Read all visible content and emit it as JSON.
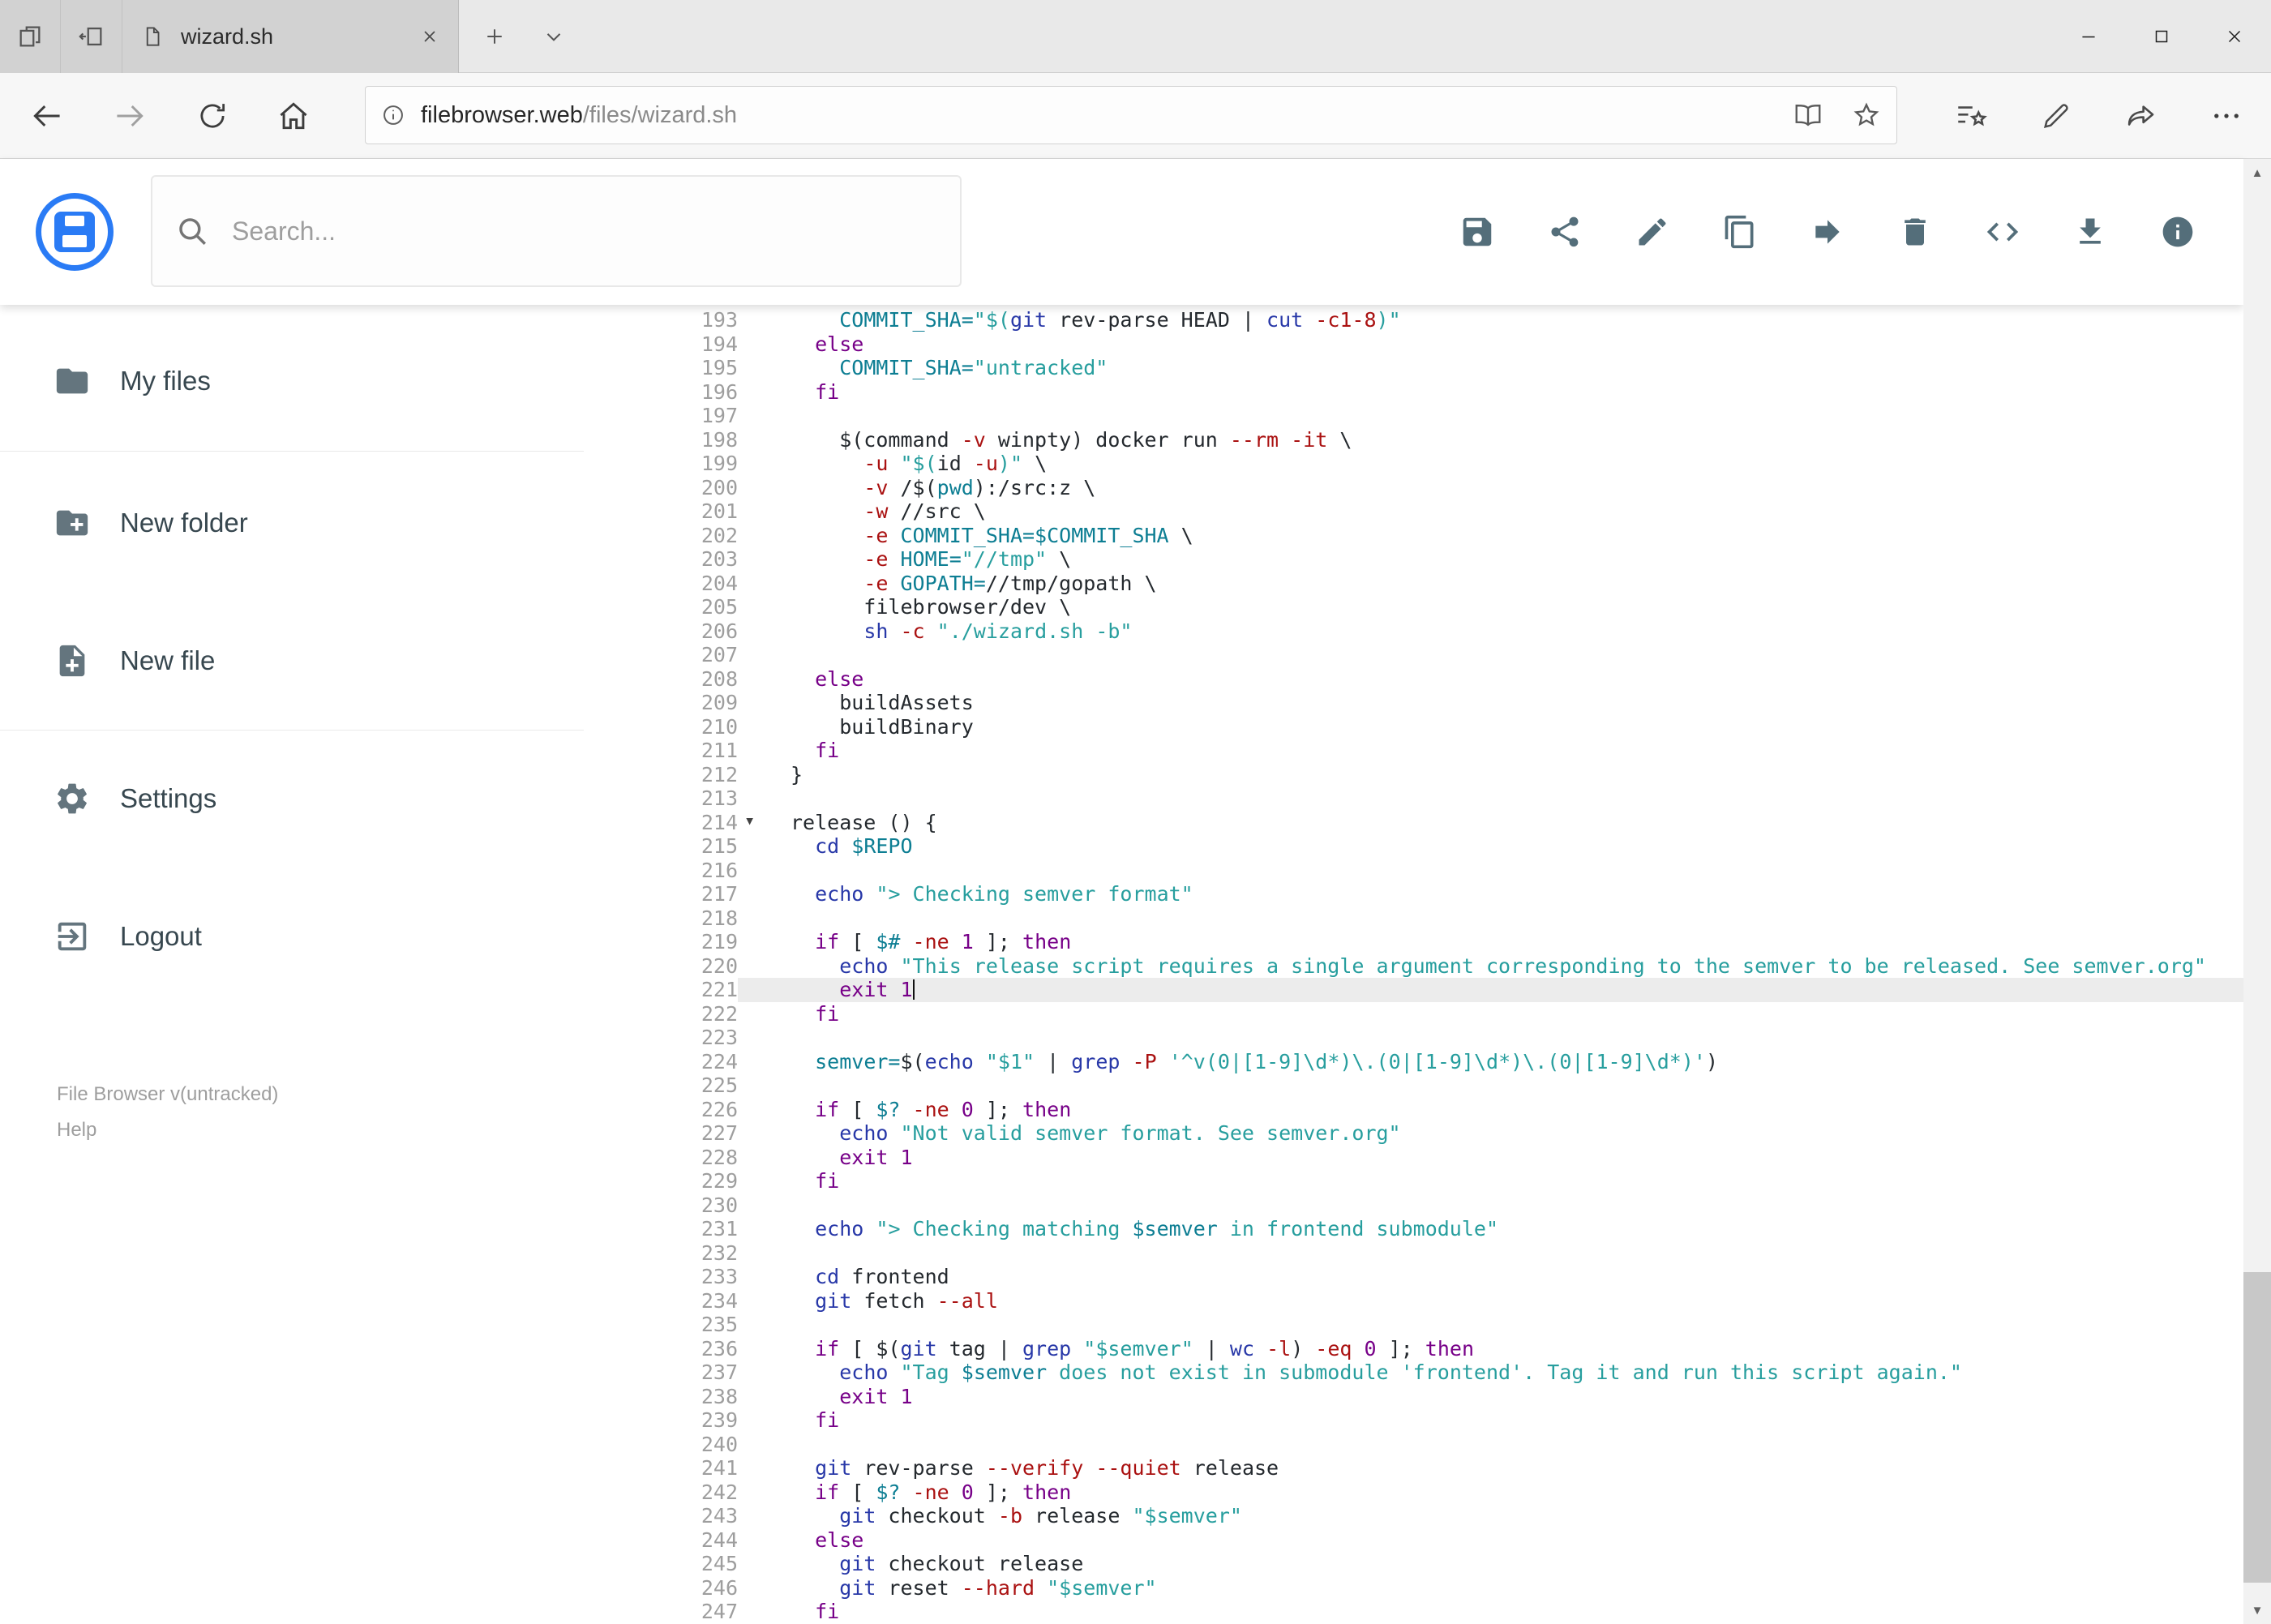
{
  "browser": {
    "tab": {
      "title": "wizard.sh"
    },
    "url": {
      "host": "filebrowser.web",
      "path": "/files/wizard.sh"
    }
  },
  "app": {
    "search": {
      "placeholder": "Search..."
    },
    "toolbar_icons": [
      "save",
      "share",
      "edit",
      "copy",
      "move",
      "delete",
      "raw-code",
      "download",
      "info"
    ],
    "sidebar": {
      "items": [
        {
          "label": "My files",
          "icon": "folder-icon"
        },
        {
          "label": "New folder",
          "icon": "new-folder-icon"
        },
        {
          "label": "New file",
          "icon": "new-file-icon"
        },
        {
          "label": "Settings",
          "icon": "settings-icon"
        },
        {
          "label": "Logout",
          "icon": "logout-icon"
        }
      ],
      "footer": {
        "version": "File Browser v(untracked)",
        "help": "Help"
      }
    }
  },
  "editor": {
    "active_line": 221,
    "cursor_line": 221,
    "fold_line": 214,
    "lines": [
      {
        "n": 193,
        "t": [
          [
            "p",
            "    "
          ],
          [
            "v",
            "COMMIT_SHA="
          ],
          [
            "s",
            "\"$("
          ],
          [
            "b",
            "git"
          ],
          [
            "p",
            " rev-parse HEAD | "
          ],
          [
            "b",
            "cut"
          ],
          [
            "p",
            " "
          ],
          [
            "f",
            "-c1-8"
          ],
          [
            "s",
            ")\""
          ]
        ]
      },
      {
        "n": 194,
        "t": [
          [
            "p",
            "  "
          ],
          [
            "k",
            "else"
          ]
        ]
      },
      {
        "n": 195,
        "t": [
          [
            "p",
            "    "
          ],
          [
            "v",
            "COMMIT_SHA="
          ],
          [
            "s",
            "\"untracked\""
          ]
        ]
      },
      {
        "n": 196,
        "t": [
          [
            "p",
            "  "
          ],
          [
            "k",
            "fi"
          ]
        ]
      },
      {
        "n": 197,
        "t": []
      },
      {
        "n": 198,
        "t": [
          [
            "p",
            "    $(command "
          ],
          [
            "f",
            "-v"
          ],
          [
            "p",
            " winpty) docker run "
          ],
          [
            "f",
            "--rm"
          ],
          [
            "p",
            " "
          ],
          [
            "f",
            "-it"
          ],
          [
            "p",
            " \\"
          ]
        ]
      },
      {
        "n": 199,
        "t": [
          [
            "p",
            "      "
          ],
          [
            "f",
            "-u"
          ],
          [
            "p",
            " "
          ],
          [
            "s",
            "\"$("
          ],
          [
            "p",
            "id "
          ],
          [
            "f",
            "-u"
          ],
          [
            "s",
            ")\""
          ],
          [
            "p",
            " \\"
          ]
        ]
      },
      {
        "n": 200,
        "t": [
          [
            "p",
            "      "
          ],
          [
            "f",
            "-v"
          ],
          [
            "p",
            " /$("
          ],
          [
            "v",
            "pwd"
          ],
          [
            "p",
            "):/src:z \\"
          ]
        ]
      },
      {
        "n": 201,
        "t": [
          [
            "p",
            "      "
          ],
          [
            "f",
            "-w"
          ],
          [
            "p",
            " //src \\"
          ]
        ]
      },
      {
        "n": 202,
        "t": [
          [
            "p",
            "      "
          ],
          [
            "f",
            "-e"
          ],
          [
            "p",
            " "
          ],
          [
            "v",
            "COMMIT_SHA=$COMMIT_SHA"
          ],
          [
            "p",
            " \\"
          ]
        ]
      },
      {
        "n": 203,
        "t": [
          [
            "p",
            "      "
          ],
          [
            "f",
            "-e"
          ],
          [
            "p",
            " "
          ],
          [
            "v",
            "HOME="
          ],
          [
            "s",
            "\"//tmp\""
          ],
          [
            "p",
            " \\"
          ]
        ]
      },
      {
        "n": 204,
        "t": [
          [
            "p",
            "      "
          ],
          [
            "f",
            "-e"
          ],
          [
            "p",
            " "
          ],
          [
            "v",
            "GOPATH="
          ],
          [
            "p",
            "//tmp/gopath \\"
          ]
        ]
      },
      {
        "n": 205,
        "t": [
          [
            "p",
            "      filebrowser/dev \\"
          ]
        ]
      },
      {
        "n": 206,
        "t": [
          [
            "p",
            "      "
          ],
          [
            "b",
            "sh"
          ],
          [
            "p",
            " "
          ],
          [
            "f",
            "-c"
          ],
          [
            "p",
            " "
          ],
          [
            "s",
            "\"./wizard.sh -b\""
          ]
        ]
      },
      {
        "n": 207,
        "t": []
      },
      {
        "n": 208,
        "t": [
          [
            "p",
            "  "
          ],
          [
            "k",
            "else"
          ]
        ]
      },
      {
        "n": 209,
        "t": [
          [
            "p",
            "    buildAssets"
          ]
        ]
      },
      {
        "n": 210,
        "t": [
          [
            "p",
            "    buildBinary"
          ]
        ]
      },
      {
        "n": 211,
        "t": [
          [
            "p",
            "  "
          ],
          [
            "k",
            "fi"
          ]
        ]
      },
      {
        "n": 212,
        "t": [
          [
            "p",
            "}"
          ]
        ]
      },
      {
        "n": 213,
        "t": []
      },
      {
        "n": 214,
        "t": [
          [
            "p",
            "release () {"
          ]
        ]
      },
      {
        "n": 215,
        "t": [
          [
            "p",
            "  "
          ],
          [
            "b",
            "cd"
          ],
          [
            "p",
            " "
          ],
          [
            "v",
            "$REPO"
          ]
        ]
      },
      {
        "n": 216,
        "t": []
      },
      {
        "n": 217,
        "t": [
          [
            "p",
            "  "
          ],
          [
            "b",
            "echo"
          ],
          [
            "p",
            " "
          ],
          [
            "s",
            "\"> Checking semver format\""
          ]
        ]
      },
      {
        "n": 218,
        "t": []
      },
      {
        "n": 219,
        "t": [
          [
            "p",
            "  "
          ],
          [
            "k",
            "if"
          ],
          [
            "p",
            " [ "
          ],
          [
            "v",
            "$#"
          ],
          [
            "p",
            " "
          ],
          [
            "f",
            "-ne"
          ],
          [
            "p",
            " "
          ],
          [
            "n",
            "1"
          ],
          [
            "p",
            " ]; "
          ],
          [
            "k",
            "then"
          ]
        ]
      },
      {
        "n": 220,
        "t": [
          [
            "p",
            "    "
          ],
          [
            "b",
            "echo"
          ],
          [
            "p",
            " "
          ],
          [
            "s",
            "\"This release script requires a single argument corresponding to the semver to be released. See semver.org\""
          ]
        ]
      },
      {
        "n": 221,
        "t": [
          [
            "p",
            "    "
          ],
          [
            "k",
            "exit"
          ],
          [
            "p",
            " "
          ],
          [
            "n",
            "1"
          ]
        ]
      },
      {
        "n": 222,
        "t": [
          [
            "p",
            "  "
          ],
          [
            "k",
            "fi"
          ]
        ]
      },
      {
        "n": 223,
        "t": []
      },
      {
        "n": 224,
        "t": [
          [
            "p",
            "  "
          ],
          [
            "v",
            "semver="
          ],
          [
            "p",
            "$("
          ],
          [
            "b",
            "echo"
          ],
          [
            "p",
            " "
          ],
          [
            "s",
            "\"$1\""
          ],
          [
            "p",
            " | "
          ],
          [
            "b",
            "grep"
          ],
          [
            "p",
            " "
          ],
          [
            "f",
            "-P"
          ],
          [
            "p",
            " "
          ],
          [
            "s",
            "'^v(0|[1-9]\\d*)\\.(0|[1-9]\\d*)\\.(0|[1-9]\\d*)'"
          ],
          [
            "p",
            ")"
          ]
        ]
      },
      {
        "n": 225,
        "t": []
      },
      {
        "n": 226,
        "t": [
          [
            "p",
            "  "
          ],
          [
            "k",
            "if"
          ],
          [
            "p",
            " [ "
          ],
          [
            "v",
            "$?"
          ],
          [
            "p",
            " "
          ],
          [
            "f",
            "-ne"
          ],
          [
            "p",
            " "
          ],
          [
            "n",
            "0"
          ],
          [
            "p",
            " ]; "
          ],
          [
            "k",
            "then"
          ]
        ]
      },
      {
        "n": 227,
        "t": [
          [
            "p",
            "    "
          ],
          [
            "b",
            "echo"
          ],
          [
            "p",
            " "
          ],
          [
            "s",
            "\"Not valid semver format. See semver.org\""
          ]
        ]
      },
      {
        "n": 228,
        "t": [
          [
            "p",
            "    "
          ],
          [
            "k",
            "exit"
          ],
          [
            "p",
            " "
          ],
          [
            "n",
            "1"
          ]
        ]
      },
      {
        "n": 229,
        "t": [
          [
            "p",
            "  "
          ],
          [
            "k",
            "fi"
          ]
        ]
      },
      {
        "n": 230,
        "t": []
      },
      {
        "n": 231,
        "t": [
          [
            "p",
            "  "
          ],
          [
            "b",
            "echo"
          ],
          [
            "p",
            " "
          ],
          [
            "s",
            "\"> Checking matching "
          ],
          [
            "v",
            "$semver"
          ],
          [
            "s",
            " in frontend submodule\""
          ]
        ]
      },
      {
        "n": 232,
        "t": []
      },
      {
        "n": 233,
        "t": [
          [
            "p",
            "  "
          ],
          [
            "b",
            "cd"
          ],
          [
            "p",
            " frontend"
          ]
        ]
      },
      {
        "n": 234,
        "t": [
          [
            "p",
            "  "
          ],
          [
            "b",
            "git"
          ],
          [
            "p",
            " fetch "
          ],
          [
            "f",
            "--all"
          ]
        ]
      },
      {
        "n": 235,
        "t": []
      },
      {
        "n": 236,
        "t": [
          [
            "p",
            "  "
          ],
          [
            "k",
            "if"
          ],
          [
            "p",
            " [ $("
          ],
          [
            "b",
            "git"
          ],
          [
            "p",
            " tag | "
          ],
          [
            "b",
            "grep"
          ],
          [
            "p",
            " "
          ],
          [
            "s",
            "\"$semver\""
          ],
          [
            "p",
            " | "
          ],
          [
            "b",
            "wc"
          ],
          [
            "p",
            " "
          ],
          [
            "f",
            "-l"
          ],
          [
            "p",
            ") "
          ],
          [
            "f",
            "-eq"
          ],
          [
            "p",
            " "
          ],
          [
            "n",
            "0"
          ],
          [
            "p",
            " ]; "
          ],
          [
            "k",
            "then"
          ]
        ]
      },
      {
        "n": 237,
        "t": [
          [
            "p",
            "    "
          ],
          [
            "b",
            "echo"
          ],
          [
            "p",
            " "
          ],
          [
            "s",
            "\"Tag "
          ],
          [
            "v",
            "$semver"
          ],
          [
            "s",
            " does not exist in submodule 'frontend'. Tag it and run this script again.\""
          ]
        ]
      },
      {
        "n": 238,
        "t": [
          [
            "p",
            "    "
          ],
          [
            "k",
            "exit"
          ],
          [
            "p",
            " "
          ],
          [
            "n",
            "1"
          ]
        ]
      },
      {
        "n": 239,
        "t": [
          [
            "p",
            "  "
          ],
          [
            "k",
            "fi"
          ]
        ]
      },
      {
        "n": 240,
        "t": []
      },
      {
        "n": 241,
        "t": [
          [
            "p",
            "  "
          ],
          [
            "b",
            "git"
          ],
          [
            "p",
            " rev-parse "
          ],
          [
            "f",
            "--verify"
          ],
          [
            "p",
            " "
          ],
          [
            "f",
            "--quiet"
          ],
          [
            "p",
            " release"
          ]
        ]
      },
      {
        "n": 242,
        "t": [
          [
            "p",
            "  "
          ],
          [
            "k",
            "if"
          ],
          [
            "p",
            " [ "
          ],
          [
            "v",
            "$?"
          ],
          [
            "p",
            " "
          ],
          [
            "f",
            "-ne"
          ],
          [
            "p",
            " "
          ],
          [
            "n",
            "0"
          ],
          [
            "p",
            " ]; "
          ],
          [
            "k",
            "then"
          ]
        ]
      },
      {
        "n": 243,
        "t": [
          [
            "p",
            "    "
          ],
          [
            "b",
            "git"
          ],
          [
            "p",
            " checkout "
          ],
          [
            "f",
            "-b"
          ],
          [
            "p",
            " release "
          ],
          [
            "s",
            "\"$semver\""
          ]
        ]
      },
      {
        "n": 244,
        "t": [
          [
            "p",
            "  "
          ],
          [
            "k",
            "else"
          ]
        ]
      },
      {
        "n": 245,
        "t": [
          [
            "p",
            "    "
          ],
          [
            "b",
            "git"
          ],
          [
            "p",
            " checkout release"
          ]
        ]
      },
      {
        "n": 246,
        "t": [
          [
            "p",
            "    "
          ],
          [
            "b",
            "git"
          ],
          [
            "p",
            " reset "
          ],
          [
            "f",
            "--hard"
          ],
          [
            "p",
            " "
          ],
          [
            "s",
            "\"$semver\""
          ]
        ]
      },
      {
        "n": 247,
        "t": [
          [
            "p",
            "  "
          ],
          [
            "k",
            "fi"
          ]
        ]
      }
    ]
  }
}
